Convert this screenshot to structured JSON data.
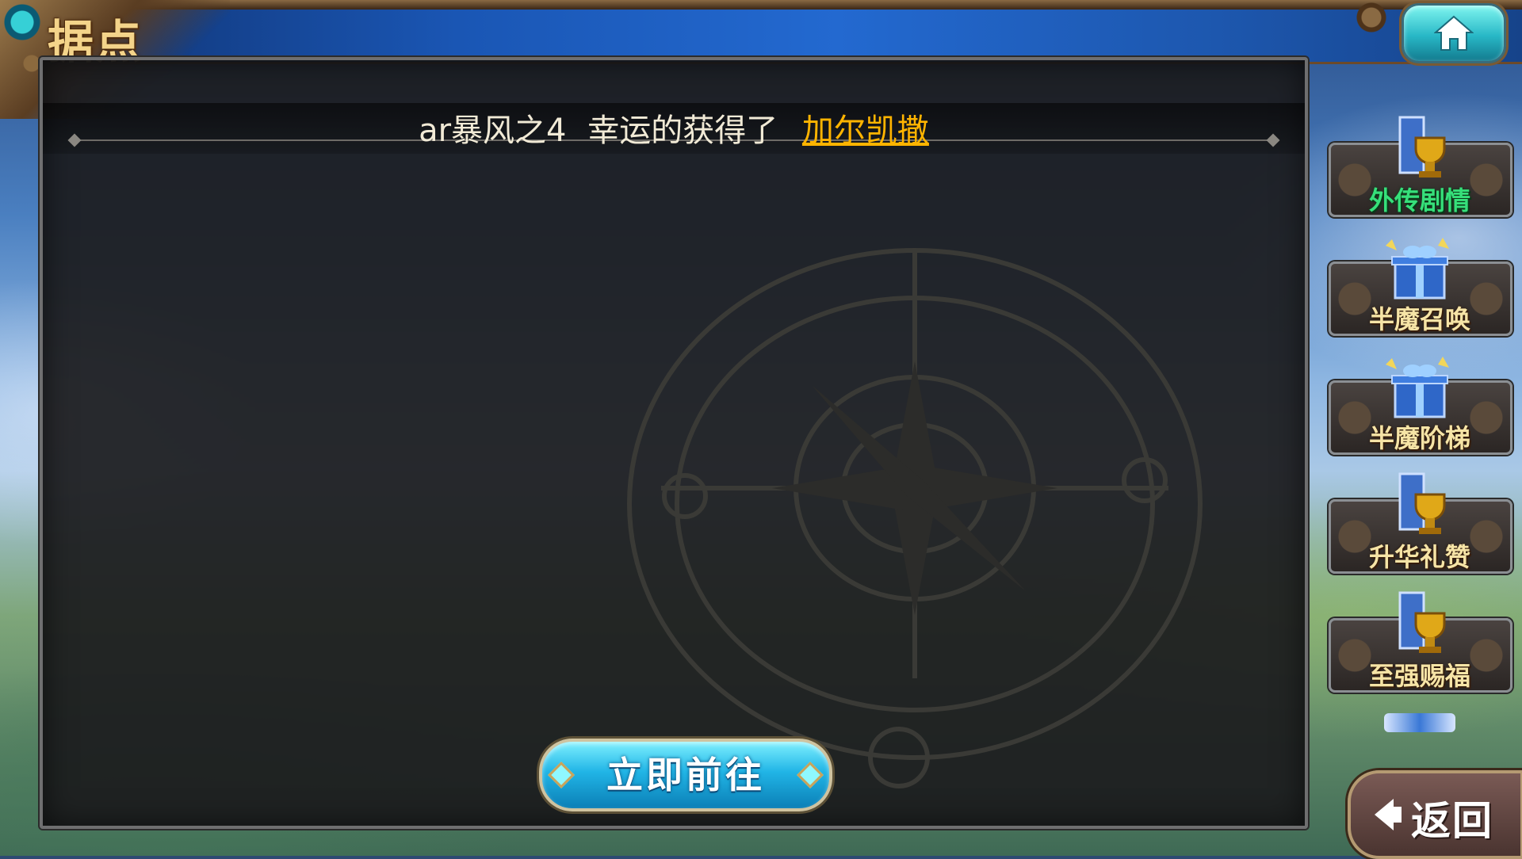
{
  "header": {
    "title": "据点",
    "home_icon": "home-icon"
  },
  "announcement": {
    "player": "ar暴风之4",
    "message": "幸运的获得了",
    "item": "加尔凯撒"
  },
  "main": {
    "go_button_label": "立即前往"
  },
  "sidebar": {
    "items": [
      {
        "label": "外传剧情",
        "icon": "trophy-icon",
        "label_color": "#36e07a"
      },
      {
        "label": "半魔召唤",
        "icon": "gift-box-icon",
        "label_color": "#f6e4a6"
      },
      {
        "label": "半魔阶梯",
        "icon": "gift-box-icon",
        "label_color": "#f6e4a6"
      },
      {
        "label": "升华礼赞",
        "icon": "trophy-icon",
        "label_color": "#f6e4a6"
      },
      {
        "label": "至强赐福",
        "icon": "trophy-icon",
        "label_color": "#f6e4a6"
      }
    ]
  },
  "footer": {
    "back_label": "返回",
    "back_icon": "back-arrow-icon"
  },
  "colors": {
    "accent_item": "#ffb400",
    "title_gold": "#f4d48a",
    "button_cyan": "#21b5e6"
  }
}
